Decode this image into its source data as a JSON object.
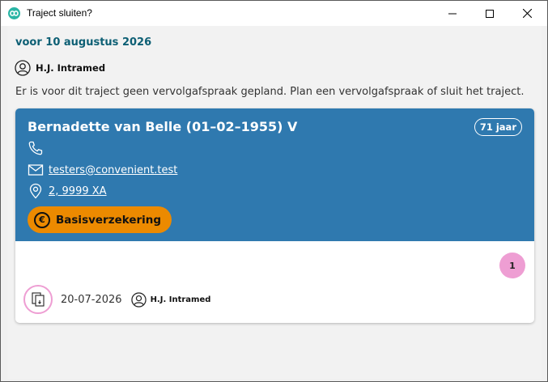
{
  "window": {
    "title": "Traject sluiten?",
    "icon": "app-logo-icon",
    "controls": [
      "minimize-icon",
      "maximize-icon",
      "close-icon"
    ]
  },
  "header": {
    "date_heading": "voor 10 augustus 2026",
    "owner": "H.J. Intramed",
    "message": "Er is voor dit traject geen vervolgafspraak gepland. Plan een vervolgafspraak of sluit het traject."
  },
  "client": {
    "name": "Bernadette van Belle (01–02–1955) V",
    "age": "71 jaar",
    "phone": "",
    "email": "testers@convenient.test",
    "address": "2, 9999 XA",
    "insurance": "Basisverzekering"
  },
  "appointments": {
    "count": "1",
    "date": "20-07-2026",
    "practitioner": "H.J. Intramed"
  },
  "colors": {
    "card_header": "#2f79af",
    "insurance": "#ec8a00",
    "badge": "#ee9ed3",
    "heading": "#0d5f74"
  }
}
